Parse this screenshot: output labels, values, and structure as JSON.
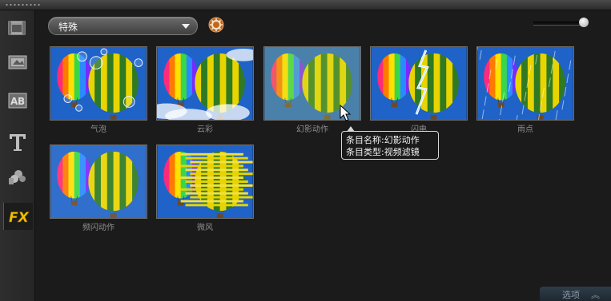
{
  "category_select": {
    "value": "特殊"
  },
  "effects": [
    {
      "label": "气泡",
      "variant": "bubbles"
    },
    {
      "label": "云彩",
      "variant": "clouds"
    },
    {
      "label": "幻影动作",
      "variant": "ghost"
    },
    {
      "label": "闪电",
      "variant": "lightning"
    },
    {
      "label": "雨点",
      "variant": "rain"
    },
    {
      "label": "频闪动作",
      "variant": "strobe"
    },
    {
      "label": "微风",
      "variant": "breeze"
    }
  ],
  "tooltip": {
    "line1": "条目名称:幻影动作",
    "line2": "条目类型:视频滤镜"
  },
  "sidebar": {
    "items": [
      "media-icon",
      "instant-project-icon",
      "transition-icon",
      "title-icon",
      "graphics-icon",
      "filter-fx-icon"
    ],
    "fx_label": "FX"
  },
  "options_button": {
    "label": "选项",
    "chevron": "︽"
  },
  "colors": {
    "background": "#1b1b1b",
    "sky": "#1f63c8",
    "balloon_yellow": "#e8d400",
    "balloon_green": "#2f7a22",
    "fx_accent": "#f2c200"
  }
}
